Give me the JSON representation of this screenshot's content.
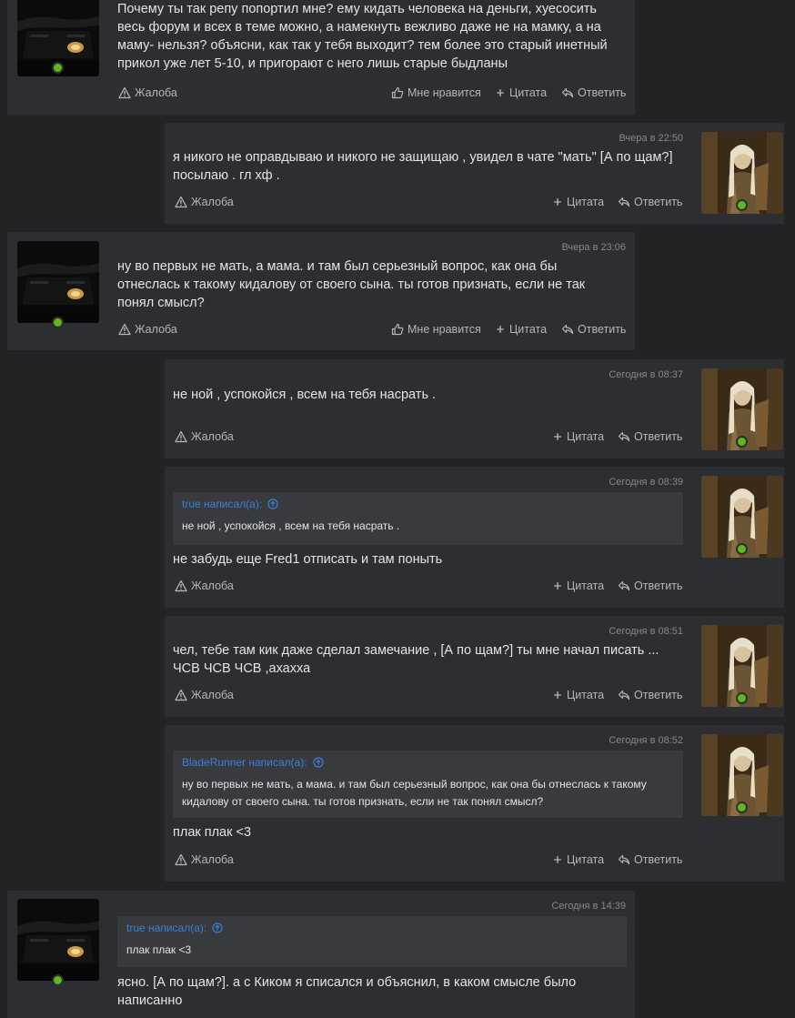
{
  "labels": {
    "report": "Жалоба",
    "like": "Мне нравится",
    "quote": "Цитата",
    "reply": "Ответить"
  },
  "posts": [
    {
      "side": "left",
      "date": "",
      "text": "Почему ты так репу попортил мне? ему кидать человека на деньги, хуесосить весь форум и всех в теме можно, а намекнуть вежливо даже не на мамку, а на маму- нельзя? объясни, как так у тебя выходит? тем более это старый инетный прикол уже лет 5-10, и пригорают с него лишь старые быдланы"
    },
    {
      "side": "right",
      "date": "Вчера в 22:50",
      "text": "я никого не оправдываю и никого не защищаю , увидел в чате \"мать\" [А по щам?] посылаю . гл хф ."
    },
    {
      "side": "left",
      "date": "Вчера в 23:06",
      "text": "ну во первых не мать, а мама. и там был серьезный вопрос, как она бы отнеслась к такому кидалову от своего сына. ты готов признать, если не так понял смысл?"
    },
    {
      "side": "right",
      "date": "Сегодня в 08:37",
      "text": "не ной , успокойся , всем на тебя насрать ."
    },
    {
      "side": "right",
      "date": "Сегодня в 08:39",
      "quote_author": "true написал(а):",
      "quote_text": "не ной , успокойся , всем на тебя насрать .",
      "text": "не забудь еще Fred1 отписать и там поныть"
    },
    {
      "side": "right",
      "date": "Сегодня в 08:51",
      "text": "чел, тебе там кик даже сделал замечание , [А по щам?] ты мне начал писать ... ЧСВ ЧСВ ЧСВ ,ахахха"
    },
    {
      "side": "right",
      "date": "Сегодня в 08:52",
      "quote_author": "BladeRunner написал(а):",
      "quote_text": "ну во первых не мать, а мама. и там был серьезный вопрос, как она бы отнеслась к такому кидалову от своего сына. ты готов признать, если не так понял смысл?",
      "text": "плак плак <3"
    },
    {
      "side": "left",
      "date": "Сегодня в 14:39",
      "quote_author": "true написал(а):",
      "quote_text": "плак плак <3",
      "text": "ясно. [А по щам?]. а с Киком я списался и объяснил, в каком смысле было написанно"
    }
  ]
}
